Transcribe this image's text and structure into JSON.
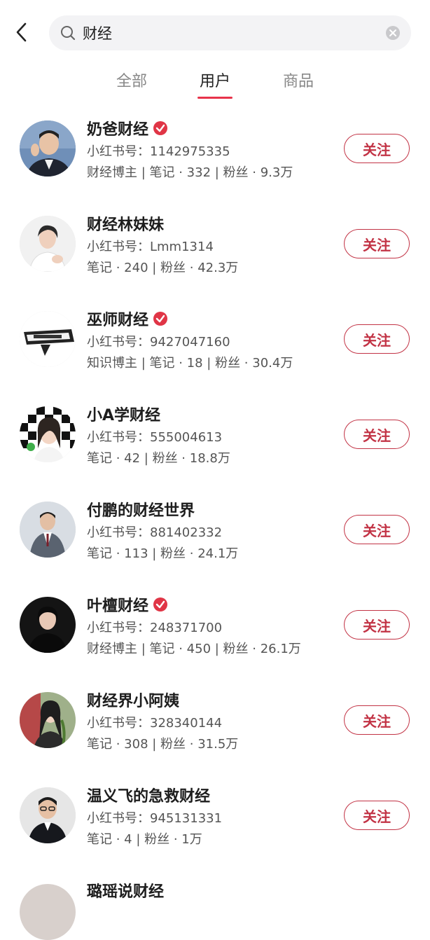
{
  "search": {
    "value": "财经"
  },
  "tabs": [
    {
      "label": "全部"
    },
    {
      "label": "用户"
    },
    {
      "label": "商品"
    }
  ],
  "follow_label": "关注",
  "users": [
    {
      "name": "奶爸财经",
      "verified": true,
      "uid": "小红书号：1142975335",
      "stats": "财经博主 | 笔记 · 332 | 粉丝 · 9.3万"
    },
    {
      "name": "财经林妹妹",
      "verified": false,
      "uid": "小红书号：Lmm1314",
      "stats": "笔记 · 240 | 粉丝 · 42.3万"
    },
    {
      "name": "巫师财经",
      "verified": true,
      "uid": "小红书号：9427047160",
      "stats": "知识博主 | 笔记 · 18 | 粉丝 · 30.4万"
    },
    {
      "name": "小A学财经",
      "verified": false,
      "uid": "小红书号：555004613",
      "stats": "笔记 · 42 | 粉丝 · 18.8万"
    },
    {
      "name": "付鹏的财经世界",
      "verified": false,
      "uid": "小红书号：881402332",
      "stats": "笔记 · 113 | 粉丝 · 24.1万"
    },
    {
      "name": "叶檀财经",
      "verified": true,
      "uid": "小红书号：248371700",
      "stats": "财经博主 | 笔记 · 450 | 粉丝 · 26.1万"
    },
    {
      "name": "财经界小阿姨",
      "verified": false,
      "uid": "小红书号：328340144",
      "stats": "笔记 · 308 | 粉丝 · 31.5万"
    },
    {
      "name": "温义飞的急救财经",
      "verified": false,
      "uid": "小红书号：945131331",
      "stats": "笔记 · 4 | 粉丝 · 1万"
    }
  ],
  "partial_user": {
    "name": "璐瑶说财经"
  },
  "colors": {
    "accent": "#c23345",
    "tab_underline": "#e8334a",
    "verified": "#e03546"
  }
}
